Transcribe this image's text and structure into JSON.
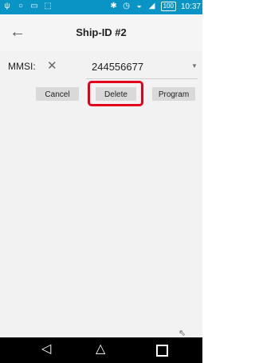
{
  "status_bar": {
    "time": "10:37",
    "battery": "100",
    "left_icons": [
      "usb-icon",
      "location-icon",
      "image-icon",
      "notification-icon"
    ],
    "right_icons": [
      "bluetooth-icon",
      "alarm-icon",
      "wifi-icon",
      "signal-icon",
      "battery-icon"
    ]
  },
  "app_bar": {
    "back_icon": "arrow-left-icon",
    "title": "Ship-ID #2"
  },
  "form": {
    "mmsi_label": "MMSI:",
    "clear_icon": "close-icon",
    "mmsi_value": "244556677",
    "dropdown_icon": "caret-down-icon"
  },
  "buttons": {
    "cancel": "Cancel",
    "delete": "Delete",
    "program": "Program"
  },
  "annotation": {
    "highlight_color": "#e3001b",
    "highlighted": "Delete"
  },
  "colors": {
    "status_bar": "#0a94c6",
    "background": "#f2f2f2",
    "button": "#d9d9d9"
  }
}
